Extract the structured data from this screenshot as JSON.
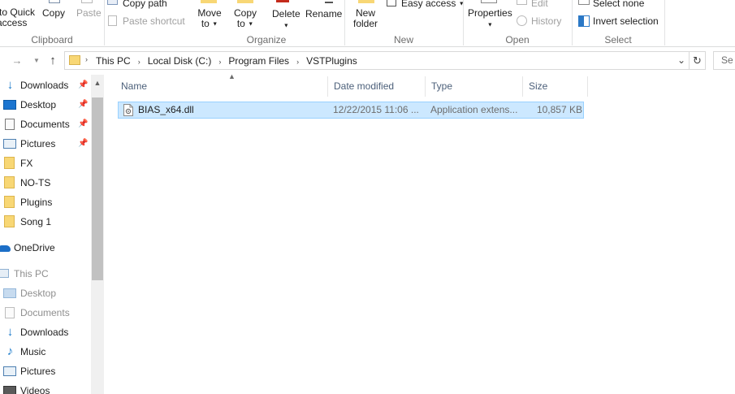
{
  "ribbon": {
    "clipboard": {
      "pin_quick_line1": "to Quick",
      "pin_quick_line2": "access",
      "copy": "Copy",
      "paste": "Paste",
      "copy_path": "Copy path",
      "paste_shortcut": "Paste shortcut",
      "label": "Clipboard"
    },
    "organize": {
      "move_to_line1": "Move",
      "move_to_line2": "to",
      "copy_to_line1": "Copy",
      "copy_to_line2": "to",
      "delete": "Delete",
      "rename": "Rename",
      "label": "Organize"
    },
    "new": {
      "new_folder_line1": "New",
      "new_folder_line2": "folder",
      "easy_access": "Easy access",
      "label": "New"
    },
    "open": {
      "properties": "Properties",
      "edit": "Edit",
      "history": "History",
      "label": "Open"
    },
    "select": {
      "select_none": "Select none",
      "invert_selection": "Invert selection",
      "label": "Select"
    }
  },
  "address": {
    "crumbs": [
      "This PC",
      "Local Disk (C:)",
      "Program Files",
      "VSTPlugins"
    ],
    "search_placeholder": "Se"
  },
  "nav": {
    "quick_access": [
      {
        "label": "Downloads",
        "icon": "download-arrow-icon",
        "pinned": true
      },
      {
        "label": "Desktop",
        "icon": "desktop-icon",
        "pinned": true
      },
      {
        "label": "Documents",
        "icon": "documents-icon",
        "pinned": true
      },
      {
        "label": "Pictures",
        "icon": "pictures-icon",
        "pinned": true
      },
      {
        "label": "FX",
        "icon": "folder-icon",
        "pinned": false
      },
      {
        "label": "NO-TS",
        "icon": "folder-icon",
        "pinned": false
      },
      {
        "label": "Plugins",
        "icon": "folder-icon",
        "pinned": false
      },
      {
        "label": "Song 1",
        "icon": "folder-icon",
        "pinned": false
      }
    ],
    "onedrive": "OneDrive",
    "this_pc": "This PC",
    "this_pc_items": [
      {
        "label": "Desktop",
        "icon": "desktop-icon"
      },
      {
        "label": "Documents",
        "icon": "documents-icon"
      },
      {
        "label": "Downloads",
        "icon": "download-arrow-icon"
      },
      {
        "label": "Music",
        "icon": "music-icon"
      },
      {
        "label": "Pictures",
        "icon": "pictures-icon"
      },
      {
        "label": "Videos",
        "icon": "videos-icon"
      }
    ]
  },
  "file_list": {
    "columns": {
      "name": "Name",
      "date_modified": "Date modified",
      "type": "Type",
      "size": "Size"
    },
    "rows": [
      {
        "name": "BIAS_x64.dll",
        "date_modified": "12/22/2015 11:06 ...",
        "type": "Application extens...",
        "size": "10,857 KB",
        "selected": true
      }
    ]
  },
  "colors": {
    "selection_fill": "#cce8ff",
    "selection_border": "#99d1ff",
    "folder_yellow": "#f8d775",
    "accent_blue": "#1979ca",
    "header_text": "#4c607a"
  }
}
